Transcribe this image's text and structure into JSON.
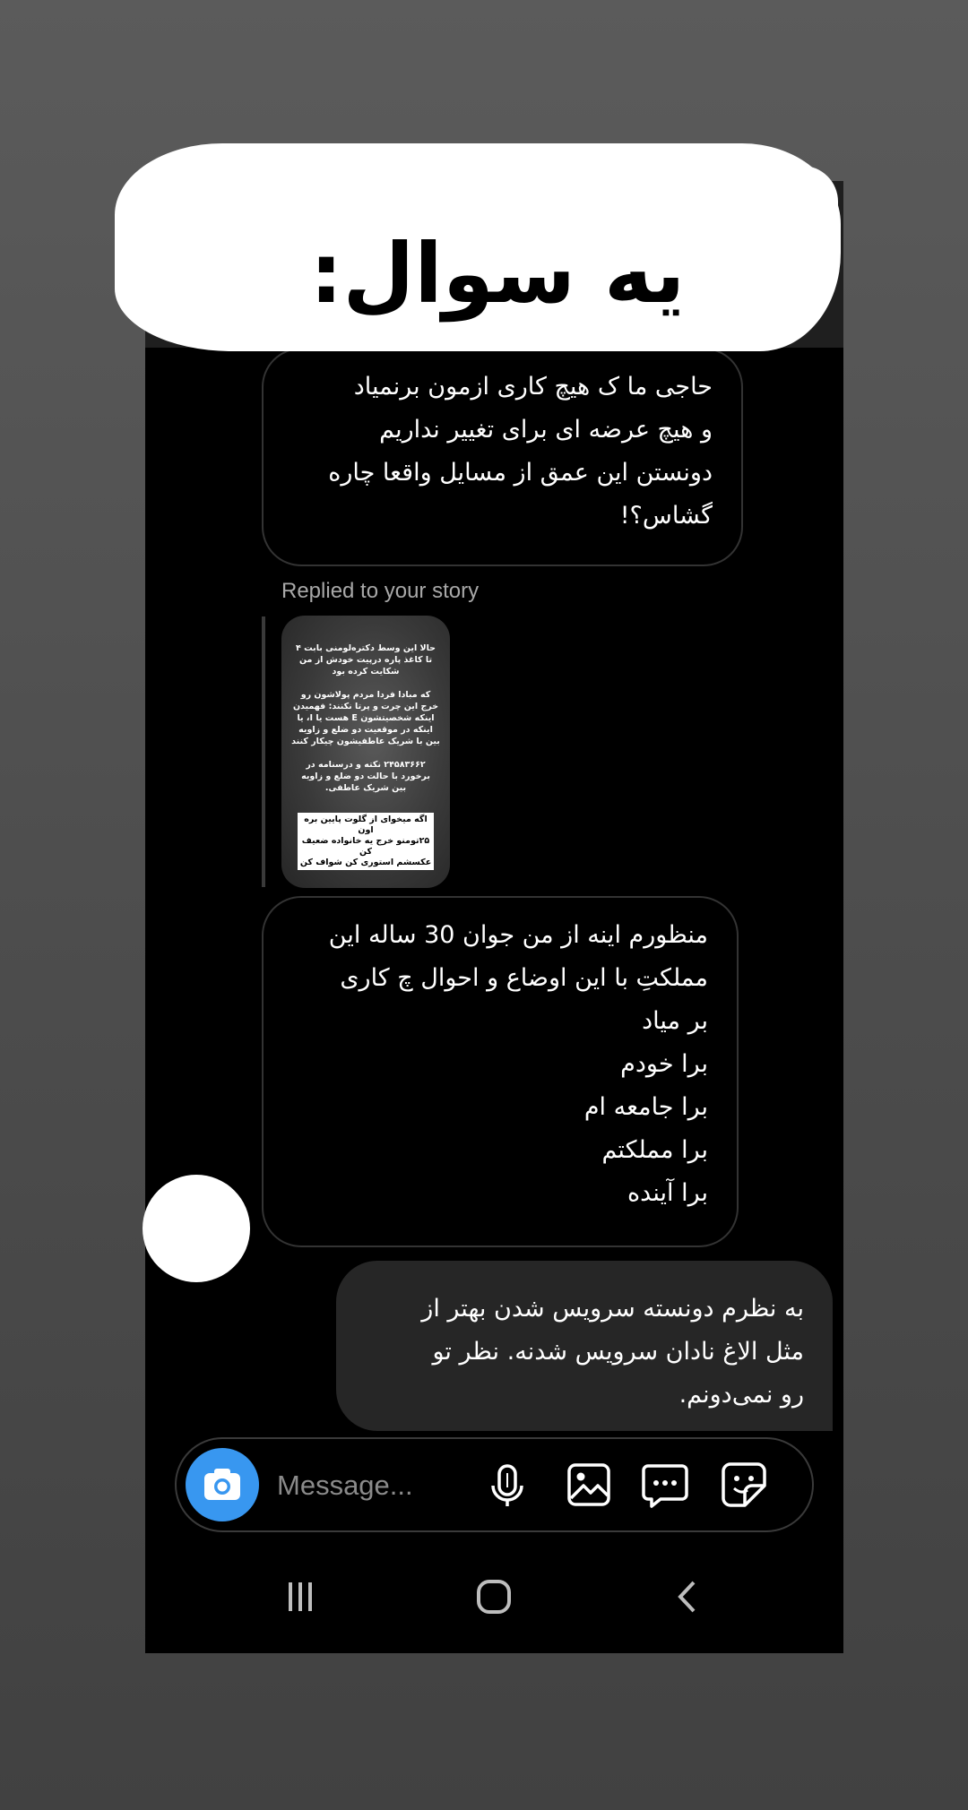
{
  "overlay_title": "یه سوال:",
  "messages": {
    "m1": "حاجی ما ک هیچ کاری ازمون برنمیاد\nو هیچ عرضه ای برای تغییر نداریم\nدونستن این عمق از مسایل واقعا چاره\nگشاس؟!",
    "replied_label": "Replied to your story",
    "story_text": "حالا این وسط دکتره‌لومنی بابت ۴\nتا کاغذ پاره درپیت خودش از من\nشکایت کرده بود\n\nکه مبادا فردا مردم پولاشون رو\nخرج این چرت و پرتا نکنند: فهمیدن\nاینکه شخصیتشون E هست یا I، یا\nاینکه در موقعیت دو ضلع و زاویه\nبین با شریک عاطفیشون چیکار کنند\n\n۲۴۵۸۳۶۶۲ نکته و درسنامه در\nبرخورد با حالت دو ضلع و زاویه\nبین شریک عاطفی.",
    "story_highlight": "اگه میخوای از گلوت پایین بره اون\n۲۵تومنو خرج یه خانواده ضعیف کن\nعکسشم استوری کن شواف کن",
    "m2": "منظورم اینه از من جوان 30 ساله این\nمملکتِ با این اوضاع و احوال چ کاری\nبر میاد\nبرا خودم\nبرا جامعه ام\nبرا مملکتم\nبرا آینده",
    "m3": "به نظرم دونسته سرویس شدن بهتر از\nمثل الاغ نادان سرویس شدنه. نظر تو\nرو نمی‌دونم."
  },
  "composer": {
    "placeholder": "Message...",
    "icons": [
      "camera-icon",
      "microphone-icon",
      "gallery-icon",
      "chat-bubble-icon",
      "sticker-icon"
    ]
  },
  "navbar": [
    "recent-apps-icon",
    "home-icon",
    "back-icon"
  ],
  "colors": {
    "accent": "#3897f0",
    "outgoing_bubble": "#262626",
    "background": "#000000"
  }
}
